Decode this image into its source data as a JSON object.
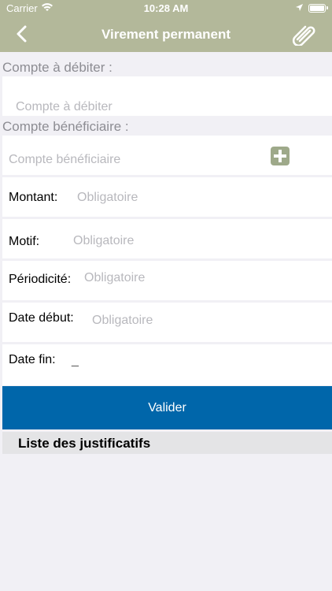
{
  "status_bar": {
    "carrier": "Carrier",
    "time": "10:28 AM"
  },
  "nav": {
    "title": "Virement permanent"
  },
  "form": {
    "compte_debiter_label": "Compte à débiter :",
    "compte_debiter_placeholder": "Compte à débiter",
    "compte_beneficiaire_label": "Compte bénéficiaire :",
    "compte_beneficiaire_placeholder": "Compte bénéficiaire",
    "montant_label": "Montant:",
    "montant_placeholder": "Obligatoire",
    "motif_label": "Motif:",
    "motif_placeholder": "Obligatoire",
    "periodicite_label": "Périodicité:",
    "periodicite_placeholder": "Obligatoire",
    "date_debut_label": "Date début:",
    "date_debut_placeholder": "Obligatoire",
    "date_fin_label": "Date fin:",
    "date_fin_value": "_"
  },
  "actions": {
    "valider": "Valider"
  },
  "justificatifs": {
    "title": "Liste des justificatifs"
  },
  "colors": {
    "header": "#b3b89a",
    "primary_button": "#0066aa",
    "accent_plus": "#9ea98a"
  }
}
